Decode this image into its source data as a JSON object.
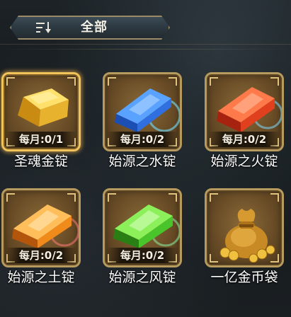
{
  "filter": {
    "label": "全部",
    "icon": "sort-list-icon"
  },
  "items": [
    {
      "name": "圣魂金锭",
      "limit": "每月:0/1",
      "color": "gold",
      "icon": "gold-ingot-icon",
      "selected": true
    },
    {
      "name": "始源之水锭",
      "limit": "每月:0/2",
      "color": "blue",
      "icon": "blue-ingot-icon"
    },
    {
      "name": "始源之火锭",
      "limit": "每月:0/2",
      "color": "red",
      "icon": "red-ingot-icon"
    },
    {
      "name": "始源之土锭",
      "limit": "每月:0/2",
      "color": "orange",
      "icon": "orange-ingot-icon"
    },
    {
      "name": "始源之风锭",
      "limit": "每月:0/2",
      "color": "green",
      "icon": "green-ingot-icon"
    },
    {
      "name": "一亿金币袋",
      "limit": "",
      "color": "gold",
      "icon": "coin-bag-icon"
    }
  ],
  "colors": {
    "frame_border": "#b69a5e",
    "frame_selected": "#f0c45a",
    "gold": "#e7b22d",
    "blue": "#2f6fe0",
    "red": "#e0401e",
    "orange": "#f08a1a",
    "green": "#49c42a"
  }
}
